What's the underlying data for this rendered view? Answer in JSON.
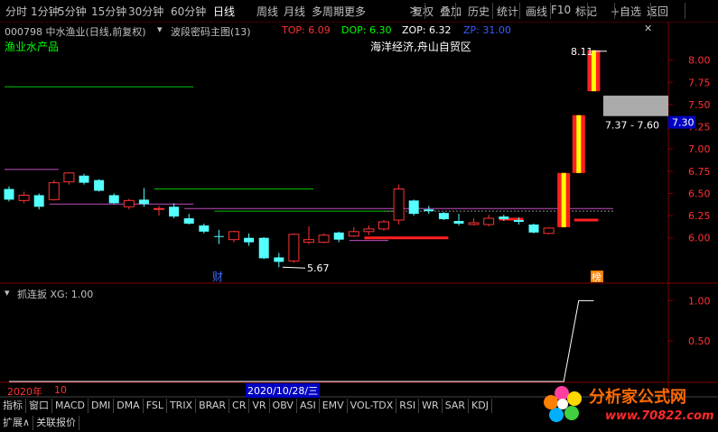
{
  "toolbar": {
    "items": [
      "分时",
      "1分钟",
      "5分钟",
      "15分钟",
      "30分钟",
      "60分钟",
      "日线",
      "周线",
      "月线",
      "多周期",
      "更多",
      "复权",
      "叠加",
      "历史",
      "统计",
      "画线",
      "F10",
      "标记",
      "+自选",
      "返回"
    ],
    "active": "日线",
    "more_arrow": ">"
  },
  "info": {
    "stock": "000798 中水渔业(日线,前复权)",
    "indicator": "波段密码主图(13)",
    "top": "TOP: 6.09",
    "dop": "DOP: 6.30",
    "zop": "ZOP: 6.32",
    "zp": "ZP: 31.00"
  },
  "annotations": {
    "sector": "渔业水产品",
    "concept": "海洋经济,舟山自贸区",
    "high_label": "8.11",
    "low_label": "5.67",
    "range_label": "7.37 - 7.60",
    "price_tag": "7.30",
    "cai_marker": "财",
    "bang_marker": "榜"
  },
  "sub_panel": {
    "title": "抓连扳 XG: 1.00"
  },
  "date_bar": {
    "year": "2020年",
    "month": "10",
    "cursor_date": "2020/10/28/三"
  },
  "tabs": [
    "指标",
    "窗口",
    "MACD",
    "DMI",
    "DMA",
    "FSL",
    "TRIX",
    "BRAR",
    "CR",
    "VR",
    "OBV",
    "ASI",
    "EMV",
    "VOL-TDX",
    "RSI",
    "WR",
    "SAR",
    "KDJ"
  ],
  "tabs_row2": [
    "扩展∧",
    "关联报价"
  ],
  "watermark": {
    "text": "分析家公式网",
    "url": "www.70822.com"
  },
  "colors": {
    "up": "#ff3232",
    "down": "#54ffff",
    "accent_yellow": "#ffff00",
    "grid": "#800000"
  },
  "chart_data": [
    {
      "type": "candlestick",
      "title": "000798 中水渔业(日线,前复权)",
      "ylim": [
        5.5,
        8.25
      ],
      "y_ticks": [
        6.0,
        6.25,
        6.5,
        6.75,
        7.0,
        7.25,
        7.5,
        7.75,
        8.0
      ],
      "candles": [
        {
          "o": 6.55,
          "h": 6.58,
          "l": 6.41,
          "c": 6.43
        },
        {
          "o": 6.42,
          "h": 6.52,
          "l": 6.39,
          "c": 6.48
        },
        {
          "o": 6.48,
          "h": 6.5,
          "l": 6.32,
          "c": 6.35
        },
        {
          "o": 6.43,
          "h": 6.65,
          "l": 6.42,
          "c": 6.62
        },
        {
          "o": 6.63,
          "h": 6.74,
          "l": 6.6,
          "c": 6.73
        },
        {
          "o": 6.7,
          "h": 6.72,
          "l": 6.6,
          "c": 6.62
        },
        {
          "o": 6.65,
          "h": 6.66,
          "l": 6.52,
          "c": 6.53
        },
        {
          "o": 6.48,
          "h": 6.5,
          "l": 6.38,
          "c": 6.39
        },
        {
          "o": 6.35,
          "h": 6.44,
          "l": 6.32,
          "c": 6.42
        },
        {
          "o": 6.43,
          "h": 6.56,
          "l": 6.35,
          "c": 6.38
        },
        {
          "o": 6.32,
          "h": 6.36,
          "l": 6.25,
          "c": 6.33
        },
        {
          "o": 6.35,
          "h": 6.39,
          "l": 6.22,
          "c": 6.24
        },
        {
          "o": 6.22,
          "h": 6.27,
          "l": 6.15,
          "c": 6.16
        },
        {
          "o": 6.14,
          "h": 6.16,
          "l": 6.05,
          "c": 6.07
        },
        {
          "o": 6.02,
          "h": 6.09,
          "l": 5.93,
          "c": 6.01
        },
        {
          "o": 5.98,
          "h": 6.08,
          "l": 5.95,
          "c": 6.07
        },
        {
          "o": 6.0,
          "h": 6.05,
          "l": 5.91,
          "c": 5.95
        },
        {
          "o": 6.0,
          "h": 6.01,
          "l": 5.76,
          "c": 5.77
        },
        {
          "o": 5.78,
          "h": 5.83,
          "l": 5.67,
          "c": 5.73
        },
        {
          "o": 5.74,
          "h": 6.05,
          "l": 5.72,
          "c": 6.04
        },
        {
          "o": 5.95,
          "h": 6.13,
          "l": 5.93,
          "c": 5.98
        },
        {
          "o": 5.95,
          "h": 6.05,
          "l": 5.94,
          "c": 6.03
        },
        {
          "o": 6.06,
          "h": 6.07,
          "l": 5.95,
          "c": 5.98
        },
        {
          "o": 6.02,
          "h": 6.12,
          "l": 6.01,
          "c": 6.07
        },
        {
          "o": 6.07,
          "h": 6.14,
          "l": 6.03,
          "c": 6.1
        },
        {
          "o": 6.1,
          "h": 6.2,
          "l": 6.08,
          "c": 6.18
        },
        {
          "o": 6.2,
          "h": 6.6,
          "l": 6.15,
          "c": 6.55
        },
        {
          "o": 6.42,
          "h": 6.43,
          "l": 6.25,
          "c": 6.27
        },
        {
          "o": 6.32,
          "h": 6.36,
          "l": 6.27,
          "c": 6.3
        },
        {
          "o": 6.28,
          "h": 6.29,
          "l": 6.2,
          "c": 6.21
        },
        {
          "o": 6.19,
          "h": 6.27,
          "l": 6.14,
          "c": 6.16
        },
        {
          "o": 6.15,
          "h": 6.22,
          "l": 6.14,
          "c": 6.17
        },
        {
          "o": 6.15,
          "h": 6.26,
          "l": 6.13,
          "c": 6.22
        },
        {
          "o": 6.24,
          "h": 6.26,
          "l": 6.19,
          "c": 6.21
        },
        {
          "o": 6.2,
          "h": 6.23,
          "l": 6.15,
          "c": 6.18
        },
        {
          "o": 6.15,
          "h": 6.16,
          "l": 6.05,
          "c": 6.06
        },
        {
          "o": 6.05,
          "h": 6.12,
          "l": 6.04,
          "c": 6.11
        },
        {
          "o": 6.12,
          "h": 6.73,
          "l": 6.12,
          "c": 6.73
        },
        {
          "o": 6.73,
          "h": 7.0,
          "l": 6.98,
          "c": 7.38
        },
        {
          "o": 7.65,
          "h": 8.11,
          "l": 7.65,
          "c": 8.11
        }
      ],
      "indicator_lines": [
        {
          "name": "green",
          "color": "#00c000",
          "y": 7.7,
          "start": 0,
          "end": 12
        },
        {
          "name": "purple",
          "color": "#c050c0",
          "y": 6.77,
          "start": 0,
          "end": 3
        },
        {
          "name": "purple2",
          "color": "#c050c0",
          "y": 6.38,
          "start": 3,
          "end": 12
        },
        {
          "name": "green2",
          "color": "#00c000",
          "y": 6.55,
          "start": 10,
          "end": 20
        },
        {
          "name": "purple3",
          "color": "#c050c0",
          "y": 6.33,
          "start": 12,
          "end": 40
        },
        {
          "name": "green3",
          "color": "#00c000",
          "y": 6.3,
          "start": 14,
          "end": 26
        }
      ],
      "highlight_box": {
        "from": 7.37,
        "to": 7.6
      }
    },
    {
      "type": "line",
      "title": "抓连扳 XG: 1.00",
      "ylim": [
        0,
        1.15
      ],
      "y_ticks": [
        0.5,
        1.0
      ],
      "values": [
        0,
        0,
        0,
        0,
        0,
        0,
        0,
        0,
        0,
        0,
        0,
        0,
        0,
        0,
        0,
        0,
        0,
        0,
        0,
        0,
        0,
        0,
        0,
        0,
        0,
        0,
        0,
        0,
        0,
        0,
        0,
        0,
        0,
        0,
        0,
        0,
        0,
        0,
        1,
        1
      ]
    }
  ]
}
